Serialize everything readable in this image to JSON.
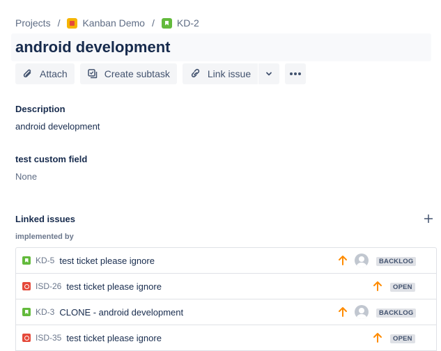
{
  "breadcrumb": {
    "projects": "Projects",
    "separator": "/",
    "project_name": "Kanban Demo",
    "issue_key": "KD-2"
  },
  "issue": {
    "title": "android development"
  },
  "toolbar": {
    "attach": "Attach",
    "create_subtask": "Create subtask",
    "link_issue": "Link issue"
  },
  "fields": {
    "description_label": "Description",
    "description_value": "android development",
    "custom_label": "test custom field",
    "custom_value": "None"
  },
  "linked_issues": {
    "heading": "Linked issues",
    "relation": "implemented by",
    "items": [
      {
        "type": "story",
        "key": "KD-5",
        "summary": "test ticket please ignore",
        "priority": "high",
        "has_assignee_avatar": true,
        "status": "BACKLOG"
      },
      {
        "type": "bug",
        "key": "ISD-26",
        "summary": "test ticket please ignore",
        "priority": "high",
        "has_assignee_avatar": false,
        "status": "OPEN"
      },
      {
        "type": "story",
        "key": "KD-3",
        "summary": "CLONE - android development",
        "priority": "high",
        "has_assignee_avatar": true,
        "status": "BACKLOG"
      },
      {
        "type": "bug",
        "key": "ISD-35",
        "summary": "test ticket please ignore",
        "priority": "high",
        "has_assignee_avatar": false,
        "status": "OPEN"
      }
    ]
  },
  "colors": {
    "priority_high": "#ff8b00",
    "story": "#63ba3c",
    "bug": "#e5493a",
    "text_primary": "#172b4d",
    "text_muted": "#5e6c84"
  }
}
